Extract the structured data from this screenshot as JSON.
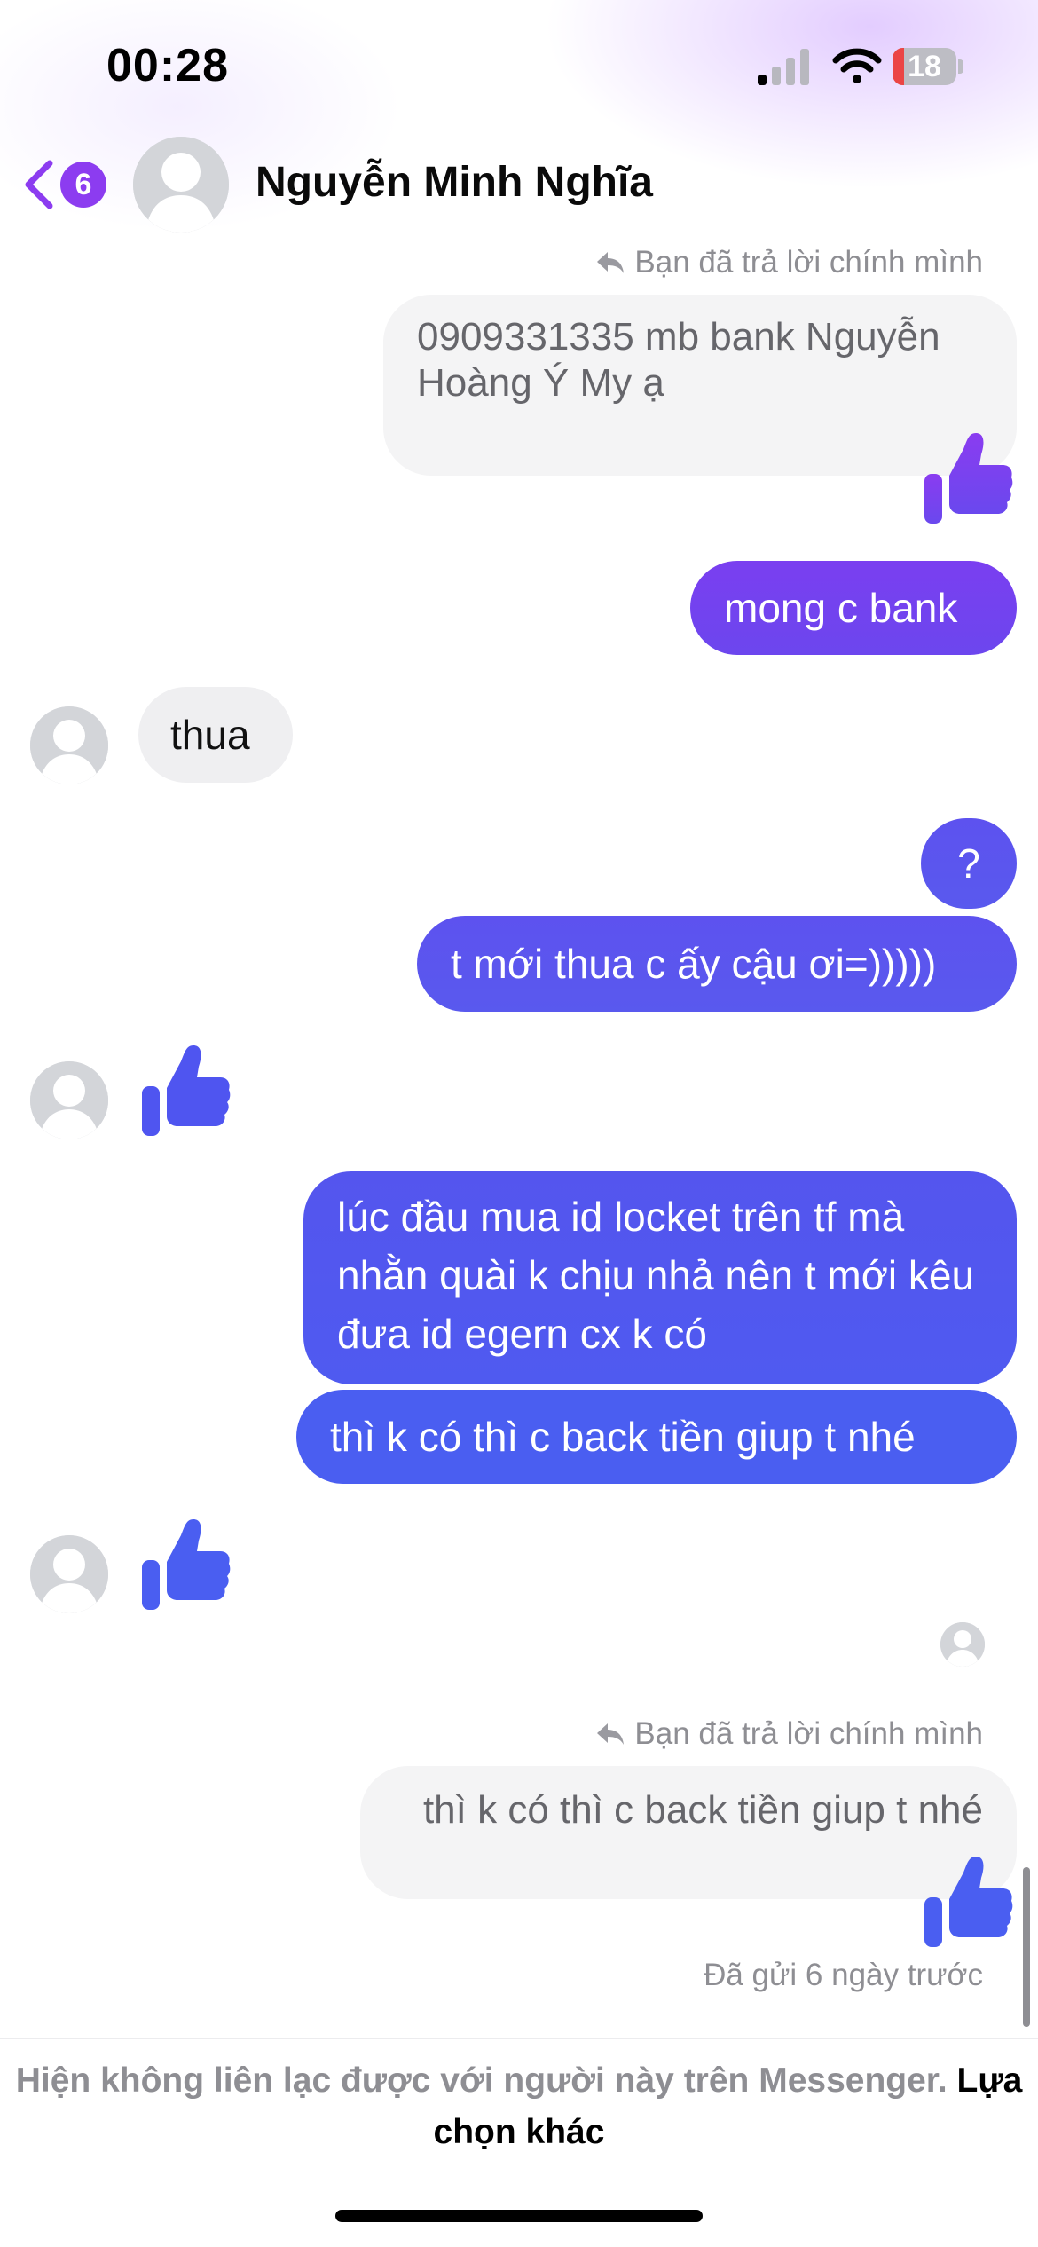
{
  "status_bar": {
    "time": "00:28",
    "battery_level": "18",
    "battery_fraction": 0.18
  },
  "header": {
    "back_badge": "6",
    "contact_name": "Nguyễn Minh Nghĩa"
  },
  "messages": {
    "reply_note_1": "Bạn đã trả lời chính mình",
    "quoted_1": "0909331335 mb bank Nguyễn Hoàng Ý My ạ",
    "out_1": "mong c bank",
    "in_1": "thua",
    "out_2": "?",
    "out_3": "t mới thua c ấy cậu ơi=)))))",
    "out_4": "lúc đầu mua id locket trên tf mà nhằn quài k chịu nhả nên t mới kêu đưa id egern cx k có",
    "out_5": "thì k có thì c back tiền giup t nhé",
    "reply_note_2": "Bạn đã trả lời chính mình",
    "quoted_2": "thì k có thì c back tiền giup t nhé",
    "sent_status": "Đã gửi 6 ngày trước"
  },
  "footer": {
    "notice": "Hiện không liên lạc được với người này trên Messenger.",
    "link": "Lựa chọn khác"
  },
  "colors": {
    "accent_purple": "#8c3cf0",
    "bubble_purple": "#6a4cef",
    "bubble_blue": "#4a5ef1",
    "incoming_bubble": "#efeff1",
    "secondary_text": "#8e8e93"
  },
  "icons": [
    "chevron-left-icon",
    "reply-arrow-icon",
    "thumbs-up-icon",
    "avatar-placeholder-icon",
    "signal-icon",
    "wifi-icon",
    "battery-icon"
  ]
}
